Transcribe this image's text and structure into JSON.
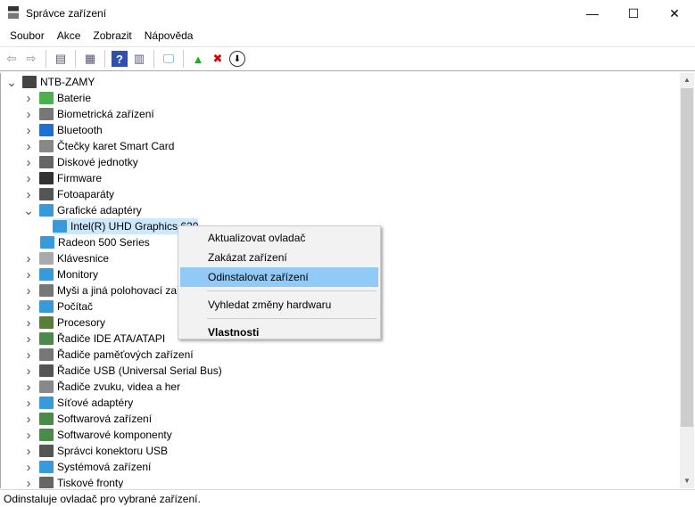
{
  "window": {
    "title": "Správce zařízení",
    "minimize": "—",
    "maximize": "☐",
    "close": "✕"
  },
  "menu": [
    "Soubor",
    "Akce",
    "Zobrazit",
    "Nápověda"
  ],
  "toolbar": [
    {
      "icon": "back-icon",
      "glyph": "⇦"
    },
    {
      "icon": "forward-icon",
      "glyph": "⇨"
    },
    {
      "icon": "show-hide-console-tree-icon",
      "glyph": "▤"
    },
    {
      "icon": "properties-icon",
      "glyph": "▦"
    },
    {
      "icon": "help-icon",
      "glyph": "?"
    },
    {
      "icon": "action-pane-icon",
      "glyph": "▥"
    },
    {
      "icon": "scan-hardware-icon",
      "glyph": "🖵"
    },
    {
      "icon": "update-driver-icon",
      "glyph": "▲"
    },
    {
      "icon": "uninstall-icon",
      "glyph": "✖"
    },
    {
      "icon": "download-icon",
      "glyph": "⬇"
    }
  ],
  "tree": {
    "root": "NTB-ZAMY",
    "items": [
      {
        "label": "Baterie",
        "expanded": false,
        "color": "#4caf50"
      },
      {
        "label": "Biometrická zařízení",
        "expanded": false,
        "color": "#777"
      },
      {
        "label": "Bluetooth",
        "expanded": false,
        "color": "#1f6fd1"
      },
      {
        "label": "Čtečky karet Smart Card",
        "expanded": false,
        "color": "#888"
      },
      {
        "label": "Diskové jednotky",
        "expanded": false,
        "color": "#666"
      },
      {
        "label": "Firmware",
        "expanded": false,
        "color": "#333"
      },
      {
        "label": "Fotoaparáty",
        "expanded": false,
        "color": "#555"
      },
      {
        "label": "Grafické adaptéry",
        "expanded": true,
        "color": "#3a9ad9",
        "children": [
          "Intel(R) UHD Graphics 620",
          "Radeon 500 Series"
        ]
      },
      {
        "label": "Klávesnice",
        "expanded": false,
        "color": "#aaa"
      },
      {
        "label": "Monitory",
        "expanded": false,
        "color": "#3a9ad9"
      },
      {
        "label": "Myši a jiná polohovací zařízení",
        "expanded": false,
        "color": "#777"
      },
      {
        "label": "Počítač",
        "expanded": false,
        "color": "#3a9ad9"
      },
      {
        "label": "Procesory",
        "expanded": false,
        "color": "#5a7d3a"
      },
      {
        "label": "Řadiče IDE ATA/ATAPI",
        "expanded": false,
        "color": "#4a8a4a"
      },
      {
        "label": "Řadiče paměťových zařízení",
        "expanded": false,
        "color": "#777"
      },
      {
        "label": "Řadiče USB (Universal Serial Bus)",
        "expanded": false,
        "color": "#555"
      },
      {
        "label": "Řadiče zvuku, videa a her",
        "expanded": false,
        "color": "#888"
      },
      {
        "label": "Síťové adaptéry",
        "expanded": false,
        "color": "#3a9ad9"
      },
      {
        "label": "Softwarová zařízení",
        "expanded": false,
        "color": "#4a8a4a"
      },
      {
        "label": "Softwarové komponenty",
        "expanded": false,
        "color": "#4a8a4a"
      },
      {
        "label": "Správci konektoru USB",
        "expanded": false,
        "color": "#555"
      },
      {
        "label": "Systémová zařízení",
        "expanded": false,
        "color": "#3a9ad9"
      },
      {
        "label": "Tiskové fronty",
        "expanded": false,
        "color": "#666"
      }
    ]
  },
  "context_menu": {
    "items": [
      "Aktualizovat ovladač",
      "Zakázat zařízení",
      "Odinstalovat zařízení",
      "Vyhledat změny hardwaru",
      "Vlastnosti"
    ],
    "highlighted": 2
  },
  "status": "Odinstaluje ovladač pro vybrané zařízení."
}
